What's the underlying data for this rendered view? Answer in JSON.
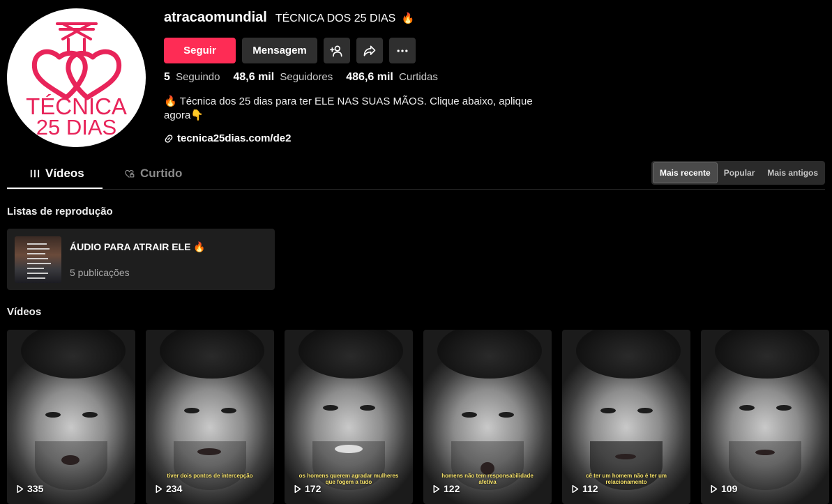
{
  "profile": {
    "avatar_text_line1": "TÉCNICA",
    "avatar_text_line2": "25 DIAS",
    "username": "atracaomundial",
    "nickname": "TÉCNICA DOS 25 DIAS",
    "nickname_emoji": "fire-emoji",
    "bio": "🔥 Técnica dos 25 dias para ter ELE NAS SUAS MÃOS. Clique abaixo, aplique agora👇",
    "link": "tecnica25dias.com/de2"
  },
  "actions": {
    "follow_label": "Seguir",
    "message_label": "Mensagem",
    "icons": [
      "add-friend-icon",
      "share-icon",
      "more-icon"
    ]
  },
  "stats": {
    "following_value": "5",
    "following_label": "Seguindo",
    "followers_value": "48,6 mil",
    "followers_label": "Seguidores",
    "likes_value": "486,6 mil",
    "likes_label": "Curtidas"
  },
  "tabs": {
    "videos_label": "Vídeos",
    "liked_label": "Curtido"
  },
  "sort": {
    "recent": "Mais recente",
    "popular": "Popular",
    "oldest": "Mais antigos",
    "selected": "Mais recente"
  },
  "playlists": {
    "section_title": "Listas de reprodução",
    "items": [
      {
        "title": "ÁUDIO PARA ATRAIR ELE 🔥",
        "count": "5 publicações"
      }
    ]
  },
  "videos": {
    "section_title": "Vídeos",
    "items": [
      {
        "views": "335",
        "caption": ""
      },
      {
        "views": "234",
        "caption": "tiver dois pontos de intercepção"
      },
      {
        "views": "172",
        "caption": "os homens querem agradar mulheres que fogem a tudo"
      },
      {
        "views": "122",
        "caption": "homens não tem responsabilidade afetiva"
      },
      {
        "views": "112",
        "caption": "cê ter um homem não é ter um relacionamento"
      },
      {
        "views": "109",
        "caption": ""
      }
    ]
  },
  "colors": {
    "accent": "#fe2c55",
    "background": "#000000",
    "button_secondary": "#2f2f2f",
    "logo_pink": "#e8245a"
  }
}
